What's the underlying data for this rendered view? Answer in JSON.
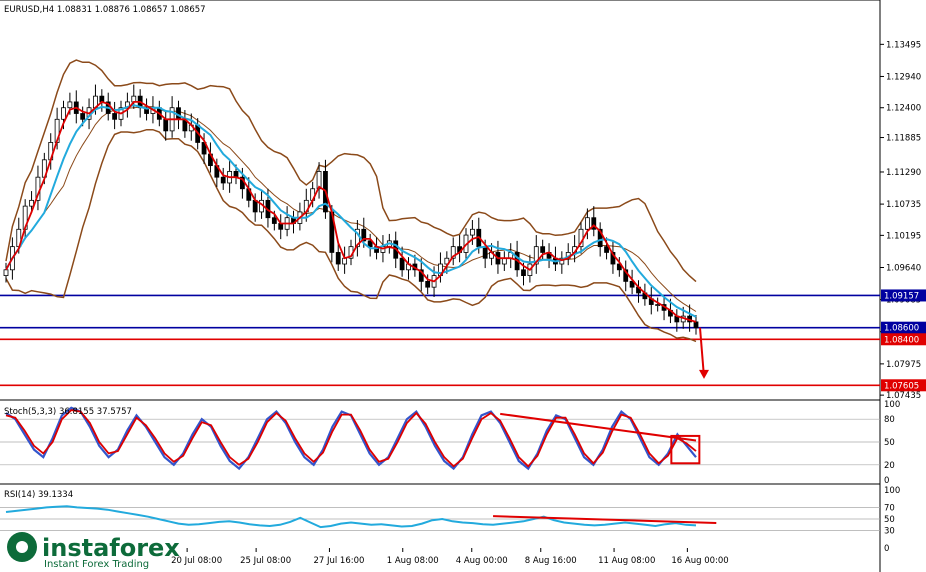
{
  "chart_data": [
    {
      "type": "candlestick",
      "title": "EURUSD,H4 1.08831 1.08876 1.08657 1.08657",
      "ylim": [
        1.0742,
        1.1395
      ],
      "y_ticks": [
        "1.13495",
        "1.12940",
        "1.12400",
        "1.11885",
        "1.11290",
        "1.10735",
        "1.10195",
        "1.09640",
        "1.09085",
        "1.08530",
        "1.07975",
        "1.07435"
      ],
      "y_tick_values": [
        1.13495,
        1.1294,
        1.124,
        1.11885,
        1.1129,
        1.10735,
        1.10195,
        1.0964,
        1.09085,
        1.0853,
        1.07975,
        1.07435
      ],
      "x_labels": [
        "20 Jul 08:00",
        "25 Jul 08:00",
        "27 Jul 16:00",
        "1 Aug 08:00",
        "4 Aug 00:00",
        "8 Aug 16:00",
        "11 Aug 08:00",
        "16 Aug 00:00"
      ],
      "x_label_bars": [
        42,
        58,
        75,
        92,
        108,
        124,
        141,
        158
      ],
      "close_path": [
        1.096,
        1.1,
        1.103,
        1.107,
        1.108,
        1.112,
        1.115,
        1.118,
        1.122,
        1.124,
        1.125,
        1.123,
        1.122,
        1.124,
        1.126,
        1.125,
        1.123,
        1.122,
        1.124,
        1.125,
        1.126,
        1.124,
        1.123,
        1.124,
        1.122,
        1.12,
        1.124,
        1.122,
        1.12,
        1.121,
        1.118,
        1.116,
        1.114,
        1.112,
        1.111,
        1.113,
        1.112,
        1.11,
        1.108,
        1.106,
        1.108,
        1.105,
        1.104,
        1.103,
        1.105,
        1.104,
        1.106,
        1.108,
        1.11,
        1.113,
        1.106,
        1.099,
        1.097,
        1.098,
        1.1,
        1.103,
        1.101,
        1.1,
        1.099,
        1.1,
        1.101,
        1.098,
        1.096,
        1.097,
        1.096,
        1.094,
        1.093,
        1.095,
        1.097,
        1.098,
        1.1,
        1.099,
        1.102,
        1.103,
        1.1,
        1.098,
        1.099,
        1.097,
        1.098,
        1.099,
        1.096,
        1.095,
        1.097,
        1.1,
        1.099,
        1.098,
        1.097,
        1.098,
        1.099,
        1.1,
        1.103,
        1.105,
        1.103,
        1.1,
        1.099,
        1.097,
        1.096,
        1.094,
        1.093,
        1.092,
        1.091,
        1.09,
        1.09,
        1.089,
        1.088,
        1.087,
        1.088,
        1.087,
        1.086
      ],
      "trend_arrow": {
        "from": 1.086,
        "to": 1.0775
      },
      "horizontal_levels": [
        {
          "price": 1.09157,
          "label": "1.09157",
          "color": "#0000a0"
        },
        {
          "price": 1.086,
          "label": "1.08600",
          "color": "#0000a0"
        },
        {
          "price": 1.084,
          "label": "1.08400",
          "color": "#e00000"
        },
        {
          "price": 1.07605,
          "label": "1.07605",
          "color": "#e00000"
        }
      ]
    },
    {
      "type": "line",
      "title": "Stoch(5,3,3) 36.8155 37.5757",
      "ylim": [
        0,
        100
      ],
      "y_ticks": [
        "100",
        "80",
        "50",
        "20",
        "0"
      ],
      "y_tick_values": [
        100,
        80,
        50,
        20,
        0
      ],
      "series": [
        {
          "values": [
            88,
            80,
            60,
            40,
            30,
            55,
            85,
            95,
            90,
            70,
            45,
            30,
            40,
            65,
            85,
            70,
            50,
            30,
            20,
            35,
            60,
            80,
            70,
            45,
            25,
            15,
            30,
            55,
            80,
            90,
            75,
            50,
            30,
            20,
            40,
            70,
            90,
            85,
            60,
            35,
            20,
            30,
            55,
            80,
            90,
            70,
            45,
            25,
            15,
            30,
            60,
            85,
            90,
            75,
            50,
            25,
            15,
            35,
            65,
            85,
            80,
            55,
            30,
            20,
            40,
            70,
            90,
            80,
            55,
            30,
            20,
            35,
            60,
            45,
            30
          ]
        },
        {
          "values": [
            85,
            82,
            65,
            45,
            35,
            50,
            80,
            92,
            90,
            75,
            50,
            35,
            38,
            60,
            82,
            72,
            55,
            35,
            24,
            32,
            55,
            76,
            72,
            50,
            30,
            20,
            28,
            50,
            76,
            88,
            78,
            55,
            35,
            24,
            36,
            64,
            86,
            86,
            65,
            40,
            24,
            28,
            50,
            75,
            88,
            74,
            50,
            30,
            18,
            28,
            55,
            80,
            88,
            78,
            55,
            30,
            18,
            32,
            60,
            82,
            82,
            60,
            35,
            22,
            36,
            64,
            86,
            82,
            60,
            35,
            22,
            32,
            55,
            48,
            38
          ]
        }
      ]
    },
    {
      "type": "line",
      "title": "RSI(14) 39.1334",
      "ylim": [
        0,
        100
      ],
      "y_ticks": [
        "100",
        "70",
        "50",
        "30",
        "0"
      ],
      "y_tick_values": [
        100,
        70,
        50,
        30,
        0
      ],
      "series": [
        {
          "values": [
            62,
            64,
            66,
            68,
            70,
            71,
            72,
            70,
            69,
            68,
            66,
            63,
            60,
            57,
            54,
            50,
            46,
            42,
            40,
            41,
            43,
            45,
            46,
            44,
            41,
            39,
            38,
            40,
            45,
            52,
            44,
            36,
            38,
            42,
            44,
            42,
            40,
            41,
            39,
            37,
            38,
            42,
            48,
            50,
            46,
            44,
            43,
            41,
            40,
            42,
            44,
            46,
            50,
            54,
            48,
            44,
            42,
            40,
            39,
            40,
            42,
            44,
            42,
            40,
            38,
            41,
            43,
            40,
            39
          ]
        }
      ]
    }
  ],
  "brand": {
    "name": "instaforex",
    "tagline": "Instant Forex Trading"
  },
  "colors": {
    "candle": "#000000",
    "ma_fast": "#dd0000",
    "ma_slow": "#22aadd",
    "bands": "#8b4a1a",
    "stoch_main": "#3355cc",
    "stoch_signal": "#dd0000",
    "rsi": "#22aadd",
    "annotation": "#e00000",
    "brand": "#0d6b3a"
  }
}
